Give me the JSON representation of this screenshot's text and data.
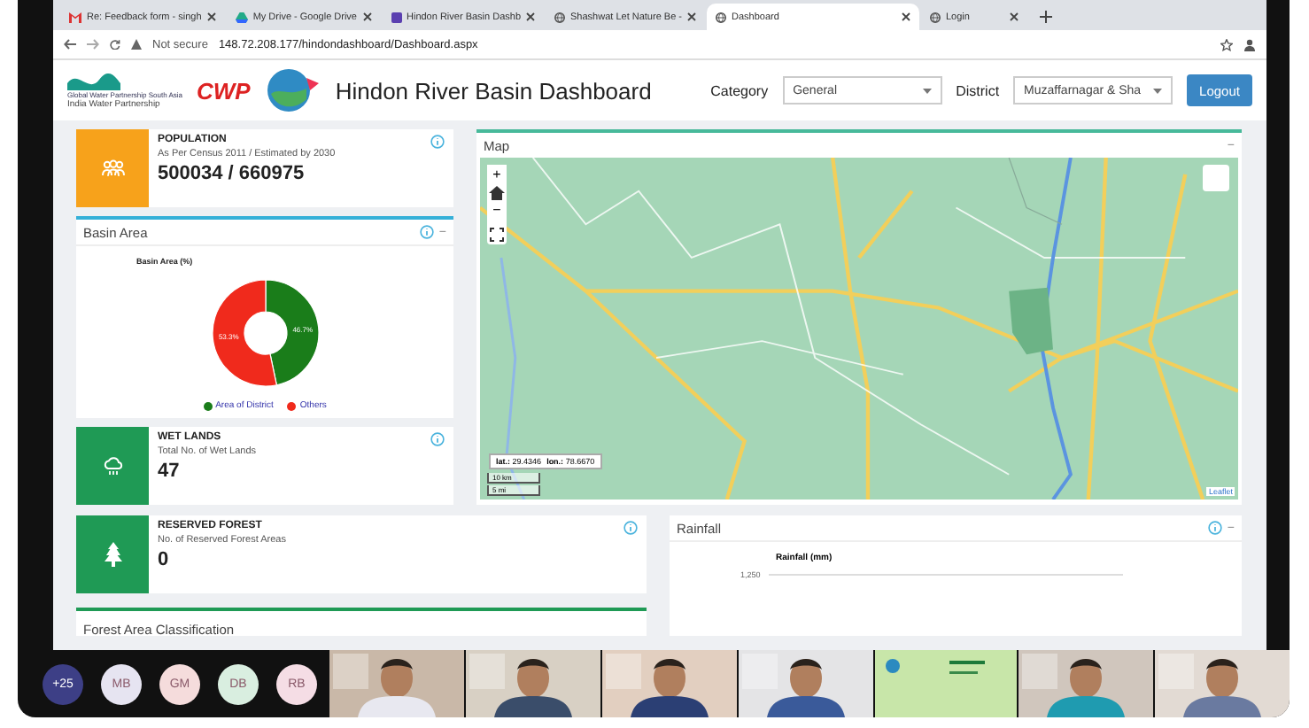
{
  "browser": {
    "tabs": [
      {
        "label": "Re: Feedback form - singh",
        "kind": "mail",
        "selected": false
      },
      {
        "label": "My Drive - Google Drive",
        "kind": "drive",
        "selected": false
      },
      {
        "label": "Hindon River Basin Dashb",
        "kind": "site",
        "selected": false
      },
      {
        "label": "Shashwat Let Nature Be - ",
        "kind": "globe",
        "selected": false
      },
      {
        "label": "Dashboard",
        "kind": "globe",
        "selected": true
      },
      {
        "label": "Login",
        "kind": "globe",
        "selected": false
      }
    ],
    "address": {
      "security": "Not secure",
      "url": "148.72.208.177/hindondashboard/Dashboard.aspx"
    }
  },
  "header": {
    "partner_text": "Global Water Partnership South Asia",
    "partner_caption": "India Water Partnership",
    "cwp": "CWP",
    "title": "Hindon River Basin Dashboard",
    "filters": [
      {
        "label": "Category",
        "value": "General"
      },
      {
        "label": "District",
        "value": "Muzaffarnagar & Sha"
      }
    ],
    "logout": "Logout"
  },
  "stats": [
    {
      "kind": "population",
      "color": "#f7a21b",
      "title": "POPULATION",
      "subtitle": "As Per Census 2011 / Estimated by 2030",
      "value": "500034 / 660975"
    },
    {
      "kind": "wetlands",
      "color": "#1f9a55",
      "title": "WET LANDS",
      "subtitle": "Total No. of Wet Lands",
      "value": "47"
    },
    {
      "kind": "forest",
      "color": "#1f9a55",
      "title": "RESERVED FOREST",
      "subtitle": "No. of Reserved Forest Areas",
      "value": "0"
    }
  ],
  "basin_area": {
    "title": "Basin Area",
    "collapse": "−",
    "chart_data": {
      "type": "donut",
      "title": "Basin Area (%)",
      "categories": [
        "Area of District",
        "Others"
      ],
      "values": [
        46.7,
        53.3
      ],
      "colors": [
        "#1a7d1a",
        "#f02a1c"
      ],
      "value_labels": [
        "46.7%",
        "53.3%"
      ]
    }
  },
  "map": {
    "title": "Map",
    "collapse": "−",
    "zoom_in": "+",
    "zoom_out": "−",
    "coordinates": [
      {
        "label": "lat.:",
        "value": "29.4346"
      },
      {
        "label": "lon.:",
        "value": "78.6670"
      }
    ],
    "scale": [
      "10 km",
      "5 mi"
    ],
    "attribution": "Leaflet"
  },
  "rainfall": {
    "title": "Rainfall",
    "collapse": "−",
    "chart_title": "Rainfall (mm)",
    "tick": "1,250"
  },
  "forest_classification": {
    "title": "Forest Area Classification"
  },
  "call": {
    "participants": [
      {
        "initials": "+25",
        "color": "#3d3f86"
      },
      {
        "initials": "MB",
        "color": "#e6e4f1"
      },
      {
        "initials": "GM",
        "color": "#f5dcdc"
      },
      {
        "initials": "DB",
        "color": "#d9eee0"
      },
      {
        "initials": "RB",
        "color": "#f5dde5"
      }
    ],
    "tiles": [
      {
        "kind": "person"
      },
      {
        "kind": "person"
      },
      {
        "kind": "person"
      },
      {
        "kind": "person"
      },
      {
        "kind": "slide"
      },
      {
        "kind": "person"
      },
      {
        "kind": "person"
      }
    ]
  }
}
